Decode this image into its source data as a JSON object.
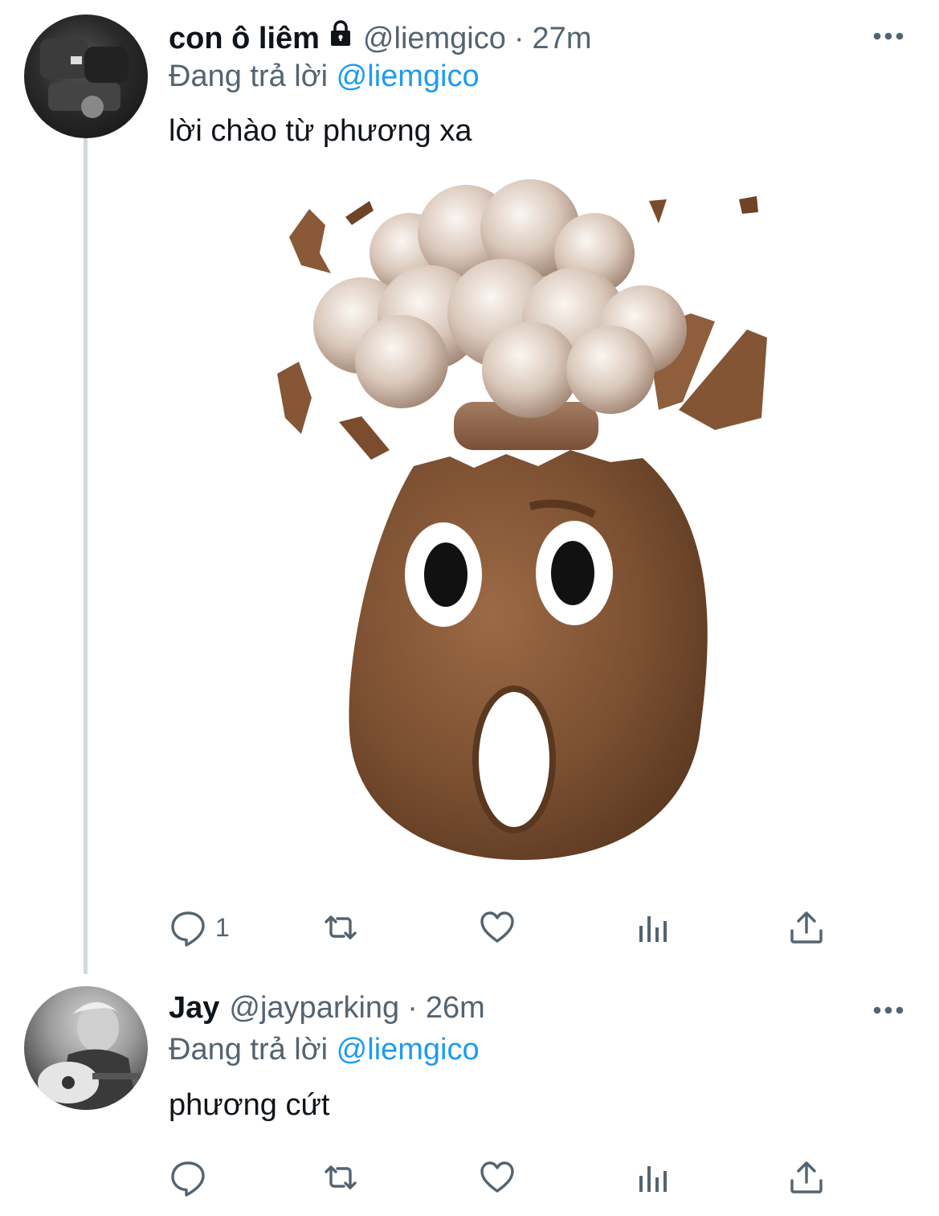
{
  "colors": {
    "text": "#0f1419",
    "secondary": "#536471",
    "link": "#1d9bf0",
    "thread_line": "#cfd9de"
  },
  "tweets": [
    {
      "display_name": "con ô liêm",
      "handle": "@liemgico",
      "dot": "·",
      "time": "27m",
      "protected": true,
      "replying_prefix": "Đang trả lời",
      "replying_to": "@liemgico",
      "text": "lời chào từ phương xa",
      "media": "exploding-head-poop-memoji",
      "reply_count": "1"
    },
    {
      "display_name": "Jay",
      "handle": "@jayparking",
      "dot": "·",
      "time": "26m",
      "replying_prefix": "Đang trả lời",
      "replying_to": "@liemgico",
      "text": "phương cứt",
      "reply_count": ""
    }
  ],
  "icons": [
    "lock-icon",
    "more-icon",
    "reply-icon",
    "retweet-icon",
    "like-icon",
    "views-icon",
    "share-icon"
  ]
}
